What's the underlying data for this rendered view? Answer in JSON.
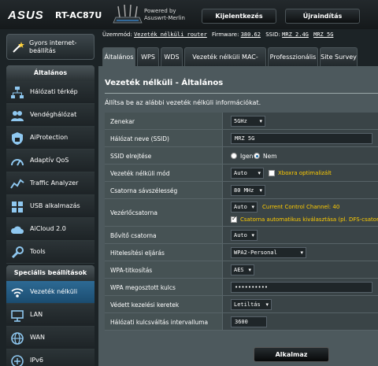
{
  "header": {
    "brand": "ASUS",
    "model": "RT-AC87U",
    "powered_by": "Powered by",
    "firmware_brand": "Asuswrt-Merlin",
    "logout": "Kijelentkezés",
    "reboot": "Újraindítás"
  },
  "status": {
    "mode_label": "Üzemmód:",
    "mode_value": "Vezeték nélküli router",
    "firmware_label": "Firmware:",
    "firmware_value": "380.62",
    "ssid_label": "SSID:",
    "ssid_24": "MRZ 2.4G",
    "ssid_5": "MRZ 5G"
  },
  "sidebar": {
    "quick_setup": "Gyors internet-beállítás",
    "general_title": "Általános",
    "general_items": [
      {
        "label": "Hálózati térkép",
        "icon": "network-map-icon"
      },
      {
        "label": "Vendéghálózat",
        "icon": "guest-network-icon"
      },
      {
        "label": "AiProtection",
        "icon": "aiprotection-icon"
      },
      {
        "label": "Adaptív QoS",
        "icon": "qos-icon"
      },
      {
        "label": "Traffic Analyzer",
        "icon": "traffic-analyzer-icon"
      },
      {
        "label": "USB alkalmazás",
        "icon": "usb-icon"
      },
      {
        "label": "AiCloud 2.0",
        "icon": "aicloud-icon"
      },
      {
        "label": "Tools",
        "icon": "tools-icon"
      }
    ],
    "advanced_title": "Speciális beállítások",
    "advanced_items": [
      {
        "label": "Vezeték nélküli",
        "icon": "wireless-icon"
      },
      {
        "label": "LAN",
        "icon": "lan-icon"
      },
      {
        "label": "WAN",
        "icon": "wan-icon"
      },
      {
        "label": "IPv6",
        "icon": "ipv6-icon"
      }
    ]
  },
  "tabs": [
    "Általános",
    "WPS",
    "WDS",
    "Vezeték nélküli MAC-szűrő",
    "Professzionális",
    "Site Survey"
  ],
  "main": {
    "title": "Vezeték nélküli - Általános",
    "description": "Állítsa be az alábbi vezeték nélküli információkat.",
    "fields": {
      "band": {
        "label": "Zenekar",
        "value": "5GHz"
      },
      "ssid": {
        "label": "Hálózat neve (SSID)",
        "value": "MRZ 5G"
      },
      "hide_ssid": {
        "label": "SSID elrejtése",
        "opt_yes": "Igen",
        "opt_no": "Nem"
      },
      "mode": {
        "label": "Vezeték nélküli mód",
        "value": "Auto",
        "checkbox_label": "Xboxra optimalizált"
      },
      "bandwidth": {
        "label": "Csatorna sávszélesség",
        "value": "80 MHz"
      },
      "control_channel": {
        "label": "Vezérlőcsatorna",
        "value": "Auto",
        "current": "Current Control Channel: 40",
        "auto_dfs": "Csatorna automatikus kiválasztása (pl. DFS-csatornák"
      },
      "ext_channel": {
        "label": "Bővítő csatorna",
        "value": "Auto"
      },
      "auth": {
        "label": "Hitelesítési eljárás",
        "value": "WPA2-Personal"
      },
      "encryption": {
        "label": "WPA-titkosítás",
        "value": "AES"
      },
      "psk": {
        "label": "WPA megosztott kulcs",
        "value": "••••••••••"
      },
      "pmf": {
        "label": "Védett kezelési keretek",
        "value": "Letiltás"
      },
      "rekey": {
        "label": "Hálózati kulcsváltás intervalluma",
        "value": "3600"
      }
    },
    "apply": "Alkalmaz"
  },
  "colors": {
    "accent_yellow": "#ffcc00",
    "active_blue": "#1f5f8a",
    "panel": "#4d595d"
  }
}
